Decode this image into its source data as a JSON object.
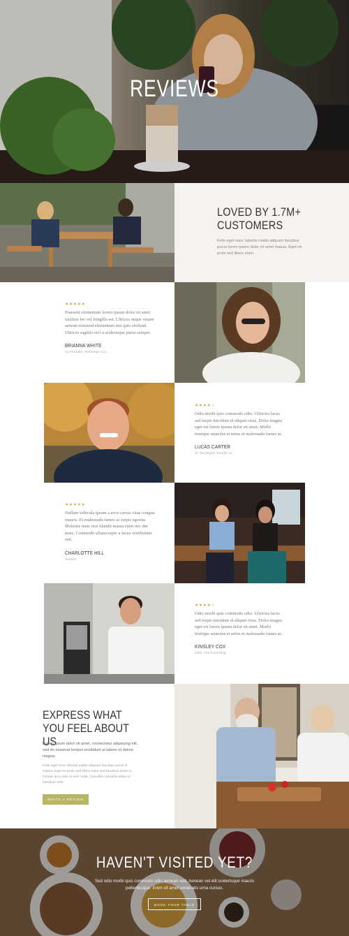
{
  "hero": {
    "title": "REVIEWS"
  },
  "loved": {
    "title": "LOVED BY 1.7M+ CUSTOMERS",
    "text": "Felis eget nunc lobortis mattis aliquam faucibus purus lorem ipsum dolor sit amet massa. Eget mi proin sed libero enim."
  },
  "reviews": [
    {
      "stars": "★★★★★",
      "quote": "Praesent elementum lorem ipsum dolor sit amet facilisis leo vel fringilla est. Ultrices neque ornare aenean euismod elementum nisi quis eleifend. Ultrices sagittis orci a scelerisque purus semper.",
      "name": "BRIANNA WHITE",
      "role": "Co-Founder, WeDesign LLC"
    },
    {
      "stars": "★★★★☆",
      "quote": "Odio morbi quis commodo odio. Ultricies lacus sed turpis tincidunt id aliquet risus. Dolor magna eget est lorem ipsum dolor sit amet. Morbi tristique senectus et netus et malesuada fames ac.",
      "name": "LUCAS CARTER",
      "role": "Sr. Developer, Dondle Inc"
    },
    {
      "stars": "★★★★★",
      "quote": "Nullam vehicula ipsum a arcu cursus vitae congue mauris. Et malesuada fames ac turpis egestas. Molestie nunc non blandit massa enim nec dui nunc. Commodo ullamcorper a lacus vestibulum sed.",
      "name": "CHARLOTTE HILL",
      "role": "Student"
    },
    {
      "stars": "★★★★☆",
      "quote": "Odio morbi quis commodo odio. Ultricies lacus sed turpis tincidunt id aliquet risus. Dolor magna eget est lorem ipsum dolor sit amet. Morbi tristique senectus et netus et malesuada fames ac.",
      "name": "KINSLEY COX",
      "role": "CEO, The Food Blog"
    }
  ],
  "express": {
    "title": "EXPRESS WHAT YOU FEEL ABOUT US",
    "subtitle": "Lorem ipsum dolor sit amet, consectetur adipiscing elit, sed do eiusmod tempor incididunt ut labore et dolore magna.",
    "text": "Felis eget nunc lobortis mattis aliquam faucibus purus in massa. Eget mi proin sed libero enim sed faucibus turpis in. Ornare arcu odio ut sem nulla. Convallis convallis tellus id interdum velit.",
    "button": "WRITE A REVIEW"
  },
  "footer": {
    "title": "HAVEN'T VISITED YET?",
    "text": "Sed odio morbi quis commodo odio aenean sed. Aenean vel elit scelerisque mauris pellentesque. Enim sit amet venenatis urna cursus.",
    "button": "BOOK YOUR TABLE"
  },
  "colors": {
    "accent": "#b8b563",
    "star": "#c9a84c",
    "panel": "#f5f2ef"
  }
}
